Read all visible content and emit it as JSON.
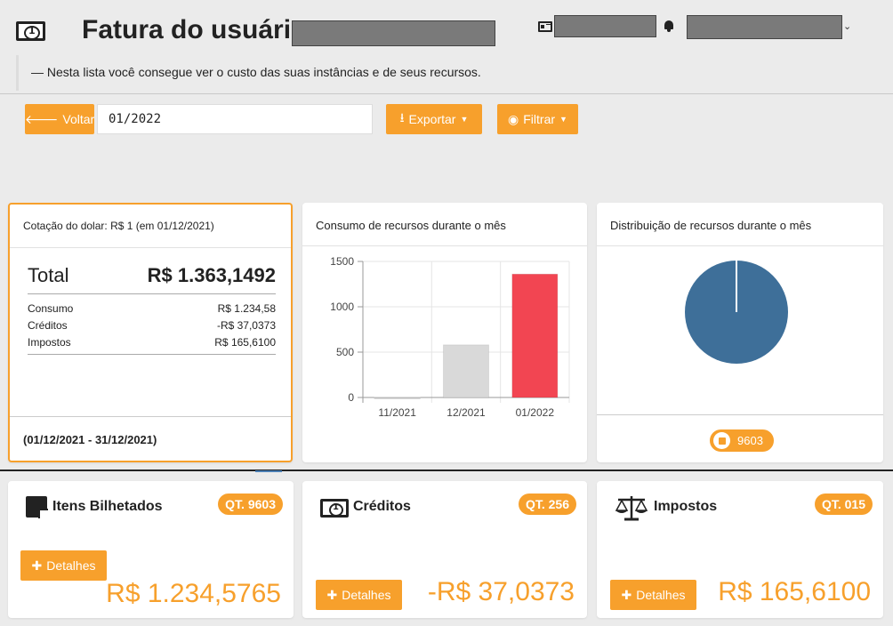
{
  "header": {
    "title": "Fatura do usuário",
    "subtitle": "— Nesta lista você consegue ver o custo das suas instâncias e de seus recursos."
  },
  "toolbar": {
    "back_label": "Voltar",
    "period_value": "01/2022",
    "export_label": "Exportar",
    "filter_label": "Filtrar"
  },
  "summary": {
    "title": "Cotação do dolar: R$ 1 (em 01/12/2021)",
    "total_label": "Total",
    "total_value": "R$ 1.363,1492",
    "rows": [
      {
        "label": "Consumo",
        "value": "R$ 1.234,58"
      },
      {
        "label": "Créditos",
        "value": "-R$ 37,0373"
      },
      {
        "label": "Impostos",
        "value": "R$ 165,6100"
      }
    ],
    "period": "(01/12/2021 - 31/12/2021)"
  },
  "bar_panel": {
    "title": "Consumo de recursos durante o mês"
  },
  "pie_panel": {
    "title": "Distribuição de recursos durante o mês",
    "badge": "9603"
  },
  "chart_data": [
    {
      "type": "bar",
      "title": "Consumo de recursos durante o mês",
      "categories": [
        "11/2021",
        "12/2021",
        "01/2022"
      ],
      "values": [
        0,
        580,
        1360
      ],
      "colors": [
        "#d9d9d9",
        "#d9d9d9",
        "#f24552"
      ],
      "ylim": [
        0,
        1500
      ],
      "yticks": [
        "0",
        "500",
        "1000",
        "1500"
      ],
      "grid": true
    },
    {
      "type": "pie",
      "title": "Distribuição de recursos durante o mês",
      "values": [
        100
      ],
      "colors": [
        "#3e6f99"
      ]
    }
  ],
  "cards": [
    {
      "title": "Itens Bilhetados",
      "badge": "QT. 9603",
      "button": "Detalhes",
      "amount": "R$ 1.234,5765",
      "icon": "note-icon"
    },
    {
      "title": "Créditos",
      "badge": "QT. 256",
      "button": "Detalhes",
      "amount": "-R$ 37,0373",
      "icon": "money-icon"
    },
    {
      "title": "Impostos",
      "badge": "QT. 015",
      "button": "Detalhes",
      "amount": "R$ 165,6100",
      "icon": "balance-scale-icon"
    }
  ],
  "colors": {
    "accent": "#f7a02c",
    "bar_highlight": "#f24552",
    "pie": "#3e6f99"
  }
}
